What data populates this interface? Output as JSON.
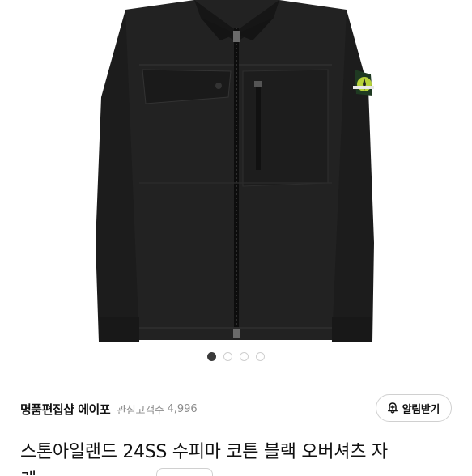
{
  "gallery": {
    "image_icon": "black-overshirt-jacket-photo",
    "slide_count": 4,
    "active_index": 0
  },
  "shop": {
    "name": "명품편집샵 에이포",
    "followers_label": "관심고객수",
    "followers_count": "4,996",
    "alert_button_label": "알림받기",
    "alert_icon": "bell-plus-icon"
  },
  "product": {
    "title": "스톤아일랜드 24SS 수피마 코튼 블랙 오버셔츠 자",
    "title_line2": "켓"
  }
}
